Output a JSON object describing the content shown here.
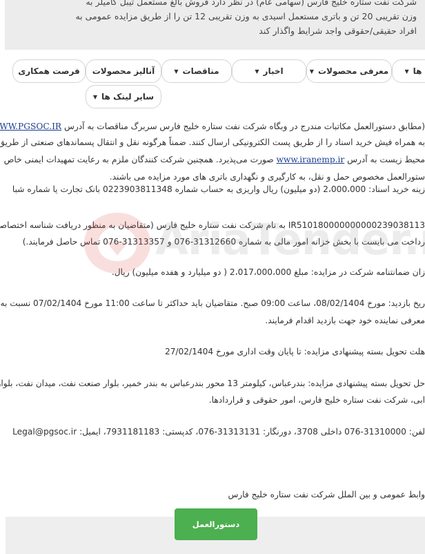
{
  "intro": {
    "lines": [
      "شرکت نفت ستاره خلیج فارس (سهامی عام) در نظر دارد فروش بالغ مستعمل تیبل کامیلر به",
      "وزن تقریبی 20 تن و باتری مستعمل اسیدی به وزن تقریبی 12 تن را از طریق مزایده عمومی به",
      "افراد حقیقی/حقوقی واجد شرایط واگذار کند"
    ]
  },
  "nav": {
    "items": [
      {
        "label": "ها",
        "caret": true
      },
      {
        "label": "معرفی محصولات",
        "caret": true
      },
      {
        "label": "اخبار",
        "caret": true
      },
      {
        "label": "مناقصات",
        "caret": true
      },
      {
        "label": "آنالیز محصولات",
        "caret": false
      },
      {
        "label": "فرصت همکاری",
        "caret": false
      },
      {
        "label": "سایر لینک ها",
        "caret": true
      }
    ]
  },
  "content": {
    "p1": [
      "(مطابق دستورالعمل مکاتبات مندرج در وبگاه شرکت نفت ستاره خلیج فارس سربرگ مناقصات به آدرس",
      "به همراه فیش خرید اسناد را از طریق پست الکترونیکی ارسال کنند. ضمناً هرگونه نقل و انتقال پسماندهای صنعتی از طریق سامانه",
      "محیط زیست به آدرس",
      "صورت می‌پذیرد. همچنین شرکت کنندگان ملزم به رعایت تمهیدات ایمنی خاص",
      "ستورالعمل مخصوص حمل و نقل، به کارگیری و نگهداری باتری های مورد مزایده می باشند."
    ],
    "url_pgsoc": "WWW.PGSOC.IR",
    "url_iranemp": "www.iranemp.ir",
    "p2": [
      "زینه خرید اسناد: 2،000،000 (دو میلیون) ریال واریزی به حساب شماره 0223903811348 بانک تجارت یا شماره شبا",
      "IR510180000000000239038113 به نام شرکت نفت ستاره خلیج فارس (متقاضیان به منظور دریافت شناسه اختصاصی",
      "رداخت می بایست با بخش خزانه امور مالی به شماره 31312660-076 و 31313357-076 تماس حاصل فرمایند.)"
    ],
    "p3": "زان ضمانتنامه شرکت در مزایده: مبلغ 2،017،000،000 ( دو میلیارد و هفده میلیون) ریال.",
    "p4": [
      "ریخ بازدید: مورخ 08/02/1404، ساعت 09:00 صبح. متقاضیان باید حداکثر تا ساعت 11:00 مورخ 07/02/1404 نسبت به",
      "معرفی نماینده خود جهت بازدید اقدام فرمایند."
    ],
    "p5": "هلت تحویل بسته پیشنهادی مزایده: تا پایان وقت اداری مورخ 27/02/1404",
    "p6": [
      "حل تحویل بسته پیشنهادی مزایده: بندرعباس، کیلومتر 13 محور بندرعباس به بندر خمیر، بلوار صنعت نفت، میدان نفت، بلوار خود",
      "ابی، شرکت نفت ستاره خلیج فارس، امور حقوقی و قراردادها."
    ],
    "p7": "لفن: 31310000-076 داخلی 3708، دورنگار: 31313131-076، کدپستی: 7931181183، ایمیل: Legal@pgsoc.ir",
    "p8": "وابط عمومی و بین الملل شرکت نفت ستاره خلیج فارس"
  },
  "footer": {
    "button_label": "دستورالعمل"
  }
}
